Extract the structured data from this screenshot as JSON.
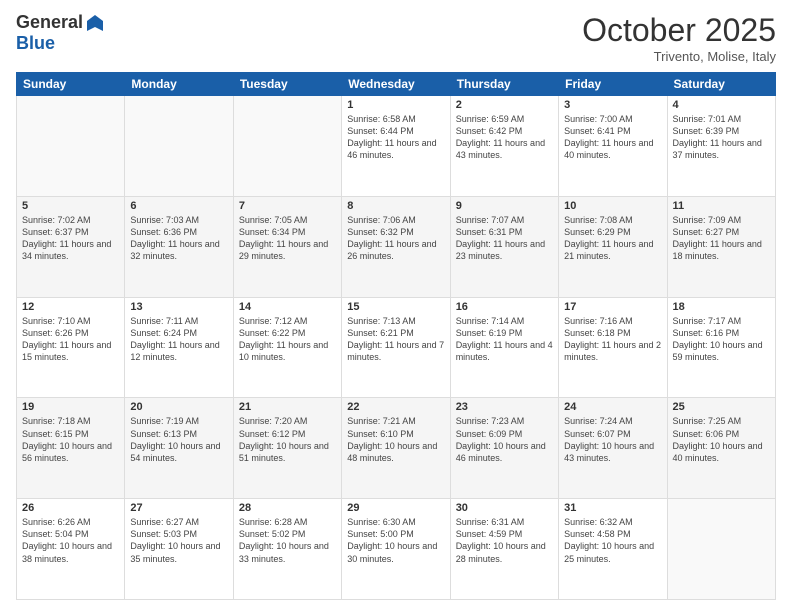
{
  "logo": {
    "general": "General",
    "blue": "Blue"
  },
  "header": {
    "month": "October 2025",
    "location": "Trivento, Molise, Italy"
  },
  "days_of_week": [
    "Sunday",
    "Monday",
    "Tuesday",
    "Wednesday",
    "Thursday",
    "Friday",
    "Saturday"
  ],
  "weeks": [
    [
      {
        "day": "",
        "sunrise": "",
        "sunset": "",
        "daylight": ""
      },
      {
        "day": "",
        "sunrise": "",
        "sunset": "",
        "daylight": ""
      },
      {
        "day": "",
        "sunrise": "",
        "sunset": "",
        "daylight": ""
      },
      {
        "day": "1",
        "sunrise": "Sunrise: 6:58 AM",
        "sunset": "Sunset: 6:44 PM",
        "daylight": "Daylight: 11 hours and 46 minutes."
      },
      {
        "day": "2",
        "sunrise": "Sunrise: 6:59 AM",
        "sunset": "Sunset: 6:42 PM",
        "daylight": "Daylight: 11 hours and 43 minutes."
      },
      {
        "day": "3",
        "sunrise": "Sunrise: 7:00 AM",
        "sunset": "Sunset: 6:41 PM",
        "daylight": "Daylight: 11 hours and 40 minutes."
      },
      {
        "day": "4",
        "sunrise": "Sunrise: 7:01 AM",
        "sunset": "Sunset: 6:39 PM",
        "daylight": "Daylight: 11 hours and 37 minutes."
      }
    ],
    [
      {
        "day": "5",
        "sunrise": "Sunrise: 7:02 AM",
        "sunset": "Sunset: 6:37 PM",
        "daylight": "Daylight: 11 hours and 34 minutes."
      },
      {
        "day": "6",
        "sunrise": "Sunrise: 7:03 AM",
        "sunset": "Sunset: 6:36 PM",
        "daylight": "Daylight: 11 hours and 32 minutes."
      },
      {
        "day": "7",
        "sunrise": "Sunrise: 7:05 AM",
        "sunset": "Sunset: 6:34 PM",
        "daylight": "Daylight: 11 hours and 29 minutes."
      },
      {
        "day": "8",
        "sunrise": "Sunrise: 7:06 AM",
        "sunset": "Sunset: 6:32 PM",
        "daylight": "Daylight: 11 hours and 26 minutes."
      },
      {
        "day": "9",
        "sunrise": "Sunrise: 7:07 AM",
        "sunset": "Sunset: 6:31 PM",
        "daylight": "Daylight: 11 hours and 23 minutes."
      },
      {
        "day": "10",
        "sunrise": "Sunrise: 7:08 AM",
        "sunset": "Sunset: 6:29 PM",
        "daylight": "Daylight: 11 hours and 21 minutes."
      },
      {
        "day": "11",
        "sunrise": "Sunrise: 7:09 AM",
        "sunset": "Sunset: 6:27 PM",
        "daylight": "Daylight: 11 hours and 18 minutes."
      }
    ],
    [
      {
        "day": "12",
        "sunrise": "Sunrise: 7:10 AM",
        "sunset": "Sunset: 6:26 PM",
        "daylight": "Daylight: 11 hours and 15 minutes."
      },
      {
        "day": "13",
        "sunrise": "Sunrise: 7:11 AM",
        "sunset": "Sunset: 6:24 PM",
        "daylight": "Daylight: 11 hours and 12 minutes."
      },
      {
        "day": "14",
        "sunrise": "Sunrise: 7:12 AM",
        "sunset": "Sunset: 6:22 PM",
        "daylight": "Daylight: 11 hours and 10 minutes."
      },
      {
        "day": "15",
        "sunrise": "Sunrise: 7:13 AM",
        "sunset": "Sunset: 6:21 PM",
        "daylight": "Daylight: 11 hours and 7 minutes."
      },
      {
        "day": "16",
        "sunrise": "Sunrise: 7:14 AM",
        "sunset": "Sunset: 6:19 PM",
        "daylight": "Daylight: 11 hours and 4 minutes."
      },
      {
        "day": "17",
        "sunrise": "Sunrise: 7:16 AM",
        "sunset": "Sunset: 6:18 PM",
        "daylight": "Daylight: 11 hours and 2 minutes."
      },
      {
        "day": "18",
        "sunrise": "Sunrise: 7:17 AM",
        "sunset": "Sunset: 6:16 PM",
        "daylight": "Daylight: 10 hours and 59 minutes."
      }
    ],
    [
      {
        "day": "19",
        "sunrise": "Sunrise: 7:18 AM",
        "sunset": "Sunset: 6:15 PM",
        "daylight": "Daylight: 10 hours and 56 minutes."
      },
      {
        "day": "20",
        "sunrise": "Sunrise: 7:19 AM",
        "sunset": "Sunset: 6:13 PM",
        "daylight": "Daylight: 10 hours and 54 minutes."
      },
      {
        "day": "21",
        "sunrise": "Sunrise: 7:20 AM",
        "sunset": "Sunset: 6:12 PM",
        "daylight": "Daylight: 10 hours and 51 minutes."
      },
      {
        "day": "22",
        "sunrise": "Sunrise: 7:21 AM",
        "sunset": "Sunset: 6:10 PM",
        "daylight": "Daylight: 10 hours and 48 minutes."
      },
      {
        "day": "23",
        "sunrise": "Sunrise: 7:23 AM",
        "sunset": "Sunset: 6:09 PM",
        "daylight": "Daylight: 10 hours and 46 minutes."
      },
      {
        "day": "24",
        "sunrise": "Sunrise: 7:24 AM",
        "sunset": "Sunset: 6:07 PM",
        "daylight": "Daylight: 10 hours and 43 minutes."
      },
      {
        "day": "25",
        "sunrise": "Sunrise: 7:25 AM",
        "sunset": "Sunset: 6:06 PM",
        "daylight": "Daylight: 10 hours and 40 minutes."
      }
    ],
    [
      {
        "day": "26",
        "sunrise": "Sunrise: 6:26 AM",
        "sunset": "Sunset: 5:04 PM",
        "daylight": "Daylight: 10 hours and 38 minutes."
      },
      {
        "day": "27",
        "sunrise": "Sunrise: 6:27 AM",
        "sunset": "Sunset: 5:03 PM",
        "daylight": "Daylight: 10 hours and 35 minutes."
      },
      {
        "day": "28",
        "sunrise": "Sunrise: 6:28 AM",
        "sunset": "Sunset: 5:02 PM",
        "daylight": "Daylight: 10 hours and 33 minutes."
      },
      {
        "day": "29",
        "sunrise": "Sunrise: 6:30 AM",
        "sunset": "Sunset: 5:00 PM",
        "daylight": "Daylight: 10 hours and 30 minutes."
      },
      {
        "day": "30",
        "sunrise": "Sunrise: 6:31 AM",
        "sunset": "Sunset: 4:59 PM",
        "daylight": "Daylight: 10 hours and 28 minutes."
      },
      {
        "day": "31",
        "sunrise": "Sunrise: 6:32 AM",
        "sunset": "Sunset: 4:58 PM",
        "daylight": "Daylight: 10 hours and 25 minutes."
      },
      {
        "day": "",
        "sunrise": "",
        "sunset": "",
        "daylight": ""
      }
    ]
  ]
}
